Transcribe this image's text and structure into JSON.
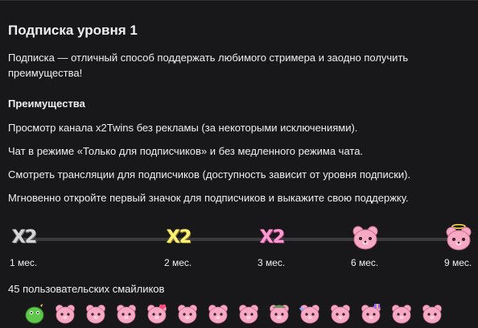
{
  "title": "Подписка уровня 1",
  "description": "Подписка — отличный способ поддержать любимого стримера и заодно получить преимущества!",
  "benefits_heading": "Преимущества",
  "benefits": [
    "Просмотр канала x2Twins без рекламы (за некоторыми исключениями).",
    "Чат в режиме «Только для подписчиков» и без медленного режима чата.",
    "Смотреть трансляции для подписчиков (доступность зависит от уровня подписки).",
    "Мгновенно откройте первый значок для подписчиков и выкажите свою поддержку."
  ],
  "badge_progress": [
    {
      "label": "1 мес.",
      "icon": "x2-gray-badge-icon",
      "text": "X2",
      "color": "#d5d5d8"
    },
    {
      "label": "2 мес.",
      "icon": "x2-yellow-badge-icon",
      "text": "X2",
      "color": "#fff07a"
    },
    {
      "label": "3 мес.",
      "icon": "x2-pink-badge-icon",
      "text": "X2",
      "color": "#ff9ad0"
    },
    {
      "label": "6 мес.",
      "icon": "pink-bear-badge-icon"
    },
    {
      "label": "9 мес.",
      "icon": "pink-bear-halo-badge-icon"
    }
  ],
  "emotes_heading": "45 пользовательских смайликов",
  "emote_icons": [
    "green-dino-emote-icon",
    "pink-bear-emote-icon",
    "pink-bear-emote-icon",
    "pink-bear-emote-icon",
    "pink-bear-heart-emote-icon",
    "pink-bear-emote-icon",
    "pink-bear-emote-icon",
    "pink-bear-emote-icon",
    "pink-bear-cap-emote-icon",
    "pink-bear-sparkle-emote-icon",
    "pink-bear-emote-icon",
    "pink-bear-gift-emote-icon",
    "pink-bear-emote-icon",
    "pink-bear-emote-icon"
  ],
  "colors": {
    "background": "#18181b",
    "text": "#efeff1",
    "track": "#3a3a3f",
    "bear_pink": "#f7a9c4"
  }
}
